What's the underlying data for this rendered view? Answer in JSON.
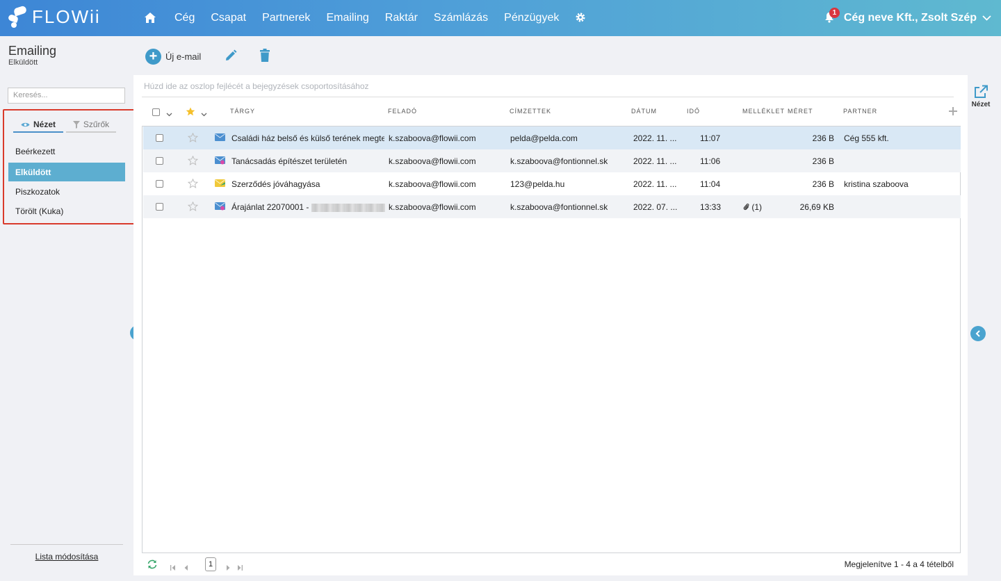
{
  "brand": {
    "name": "FLOWii"
  },
  "nav": {
    "items": [
      "Cég",
      "Csapat",
      "Partnerek",
      "Emailing",
      "Raktár",
      "Számlázás",
      "Pénzügyek"
    ]
  },
  "user": {
    "label": "Cég neve Kft., Zsolt Szép",
    "notifications": "1"
  },
  "page": {
    "title": "Emailing",
    "subtitle": "Elküldött"
  },
  "toolbar": {
    "new_email": "Új e-mail"
  },
  "sidebar": {
    "search_placeholder": "Keresés...",
    "tabs": [
      "Nézet",
      "Szűrők"
    ],
    "folders": [
      "Beérkezett",
      "Elküldött",
      "Piszkozatok",
      "Törölt (Kuka)"
    ],
    "active_folder": "Elküldött",
    "footer_link": "Lista módosítása"
  },
  "grid": {
    "group_hint": "Húzd ide az oszlop fejlécét a bejegyzések csoportosításához",
    "columns": [
      "Tárgy",
      "Feladó",
      "Címzettek",
      "Dátum",
      "Idő",
      "Melléklet",
      "Méret",
      "Partner"
    ],
    "rows": [
      {
        "subject": "Családi ház belső és külső terének megte",
        "sender": "k.szaboova@flowii.com",
        "to": "pelda@pelda.com",
        "date": "2022. 11. ...",
        "time": "11:07",
        "attachment": "",
        "size": "236 B",
        "partner": "Cég 555 kft.",
        "icon": "blue"
      },
      {
        "subject": "Tanácsadás építészet területén",
        "sender": "k.szaboova@flowii.com",
        "to": "k.szaboova@fontionnel.sk",
        "date": "2022. 11. ...",
        "time": "11:06",
        "attachment": "",
        "size": "236 B",
        "partner": "",
        "icon": "blue-pink"
      },
      {
        "subject": "Szerződés jóváhagyása",
        "sender": "k.szaboova@flowii.com",
        "to": "123@pelda.hu",
        "date": "2022. 11. ...",
        "time": "11:04",
        "attachment": "",
        "size": "236 B",
        "partner": "kristina szaboova",
        "icon": "yellow"
      },
      {
        "subject": "Árajánlat 22070001 -",
        "sender": "k.szaboova@flowii.com",
        "to": "k.szaboova@fontionnel.sk",
        "date": "2022. 07. ...",
        "time": "13:33",
        "attachment": "(1)",
        "size": "26,69 KB",
        "partner": "",
        "icon": "blue-pink"
      }
    ],
    "page": "1",
    "footer_info": "Megjelenítve 1 - 4 a 4 tételből"
  },
  "right_panel": {
    "view_label": "Nézet"
  },
  "colors": {
    "accent": "#3f9ac9",
    "selected_folder": "#5daed0",
    "highlight_border": "#d93a2b"
  }
}
